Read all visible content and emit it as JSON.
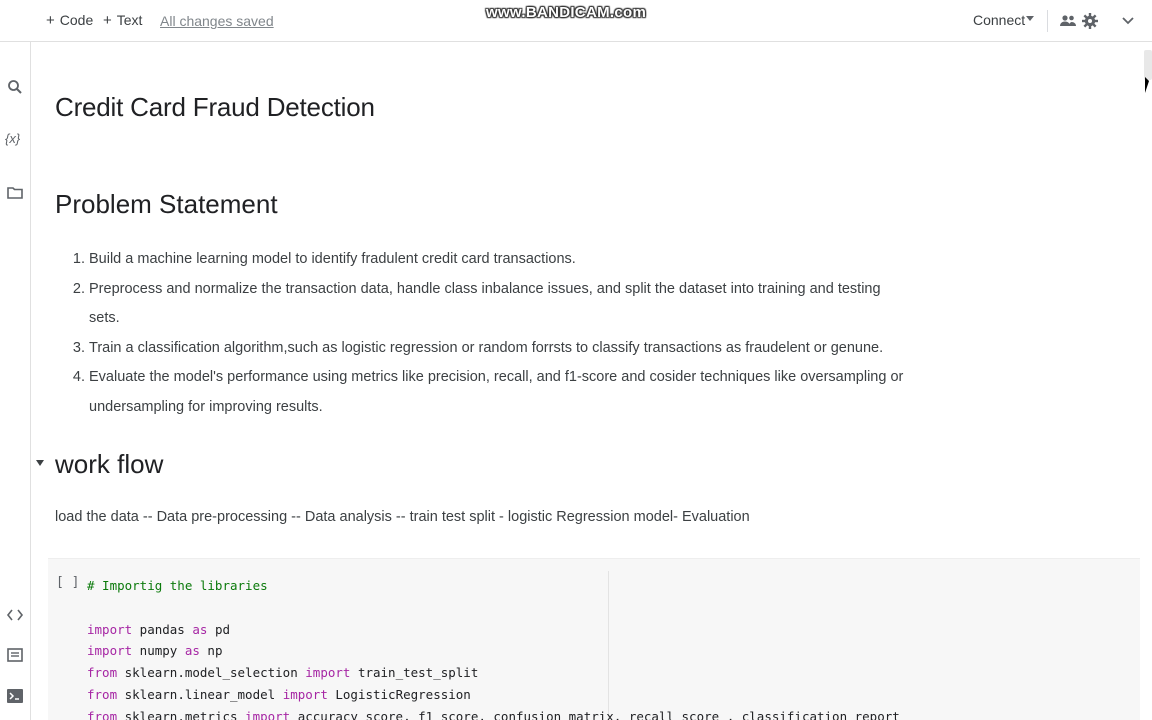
{
  "toolbar": {
    "code_label": "Code",
    "text_label": "Text",
    "plus": "+",
    "saved_status": "All changes saved",
    "watermark": "www.BANDICAM.com",
    "connect_label": "Connect"
  },
  "icons": {
    "toolbar": [
      "people-icon",
      "gear-icon",
      "chevron-down-icon"
    ],
    "rail": [
      "table-of-contents-icon",
      "search-icon",
      "variables-icon",
      "folder-icon",
      "code-snippets-icon",
      "command-palette-icon",
      "terminal-icon"
    ]
  },
  "rail": {
    "variables_text": "{x}"
  },
  "notebook": {
    "title": "Credit Card Fraud Detection",
    "problem_heading": "Problem Statement",
    "problem_steps": [
      "Build a machine learning model to identify fradulent credit card transactions.",
      "Preprocess and normalize the transaction data, handle class inbalance issues, and split the dataset into training and testing sets.",
      "Train a classification algorithm,such as logistic regression or random forrsts to classify transactions as fraudelent or genune.",
      "Evaluate the model's performance using metrics like precision, recall, and f1-score and cosider techniques like oversampling or undersampling for improving results."
    ],
    "workflow_heading": "work flow",
    "workflow_text": "load the data -- Data pre-processing -- Data analysis -- train test split - logistic Regression model- Evaluation"
  },
  "code_cell": {
    "run_indicator": "[ ]",
    "comment": "# Importig the libraries",
    "lines": [
      {
        "kw1": "import",
        "mod": " pandas ",
        "kw2": "as",
        "rest": " pd"
      },
      {
        "kw1": "import",
        "mod": " numpy ",
        "kw2": "as",
        "rest": " np"
      },
      {
        "kw1": "from",
        "mod": " sklearn.model_selection ",
        "kw2": "import",
        "rest": " train_test_split"
      },
      {
        "kw1": "from",
        "mod": " sklearn.linear_model ",
        "kw2": "import",
        "rest": " LogisticRegression"
      },
      {
        "kw1": "from",
        "mod": " sklearn.metrics ",
        "kw2": "import",
        "rest": " accuracy_score, f1_score, confusion_matrix, recall_score , classification_report"
      }
    ]
  }
}
